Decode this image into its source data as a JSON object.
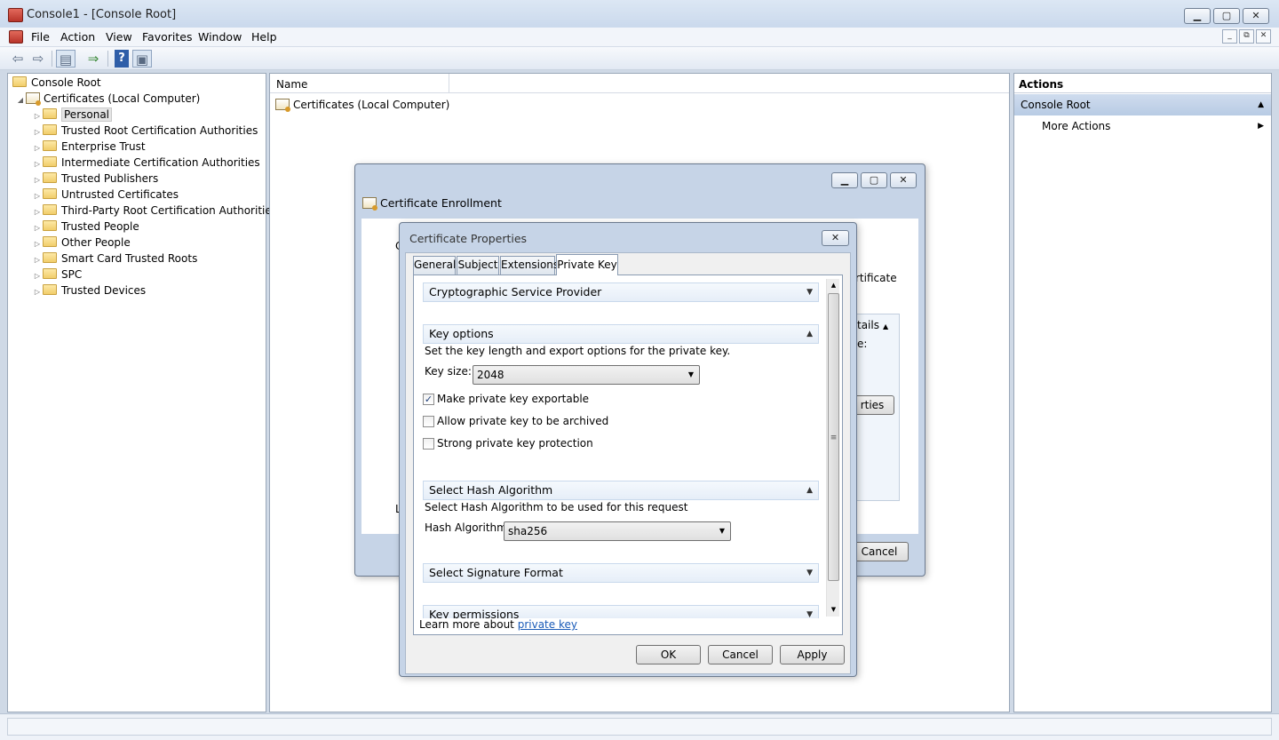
{
  "window": {
    "title": "Console1 - [Console Root]",
    "min": "▁",
    "max": "▢",
    "close": "✕"
  },
  "menu": [
    "File",
    "Action",
    "View",
    "Favorites",
    "Window",
    "Help"
  ],
  "mdi": {
    "min": "_",
    "restore": "⧉",
    "close": "✕"
  },
  "toolbar": {
    "back": "⇦",
    "forward": "⇨",
    "show_tree": "▤",
    "export": "⇒",
    "help": "?",
    "show_action": "▣"
  },
  "tree": {
    "root": "Console Root",
    "certificates": "Certificates (Local Computer)",
    "items": [
      "Personal",
      "Trusted Root Certification Authorities",
      "Enterprise Trust",
      "Intermediate Certification Authorities",
      "Trusted Publishers",
      "Untrusted Certificates",
      "Third-Party Root Certification Authorities",
      "Trusted People",
      "Other People",
      "Smart Card Trusted Roots",
      "SPC",
      "Trusted Devices"
    ]
  },
  "center": {
    "column_name": "Name",
    "row": "Certificates (Local Computer)"
  },
  "actions": {
    "header": "Actions",
    "section": "Console Root",
    "more": "More Actions"
  },
  "enrollment": {
    "title": "Certificate Enrollment",
    "frag_c": "C",
    "frag_l": "L",
    "frag_certificate": "rtificate",
    "frag_details": "tails",
    "frag_colon": "e:",
    "frag_properties": "rties",
    "cancel": "Cancel"
  },
  "props": {
    "title": "Certificate Properties",
    "tabs": [
      "General",
      "Subject",
      "Extensions",
      "Private Key"
    ],
    "csp": "Cryptographic Service Provider",
    "key_options": "Key options",
    "key_options_desc": "Set the key length and export options for the private key.",
    "key_size_label": "Key size:",
    "key_size_value": "2048",
    "cb_exportable": "Make private key exportable",
    "cb_archive": "Allow private key to be archived",
    "cb_strong": "Strong private key protection",
    "hash_section": "Select Hash Algorithm",
    "hash_desc": "Select Hash Algorithm to be used for this request",
    "hash_label": "Hash Algorithm:",
    "hash_value": "sha256",
    "sig_format": "Select Signature Format",
    "key_permissions": "Key permissions",
    "learn_more": "Learn more about",
    "learn_link": "private key",
    "ok": "OK",
    "cancel": "Cancel",
    "apply": "Apply"
  }
}
